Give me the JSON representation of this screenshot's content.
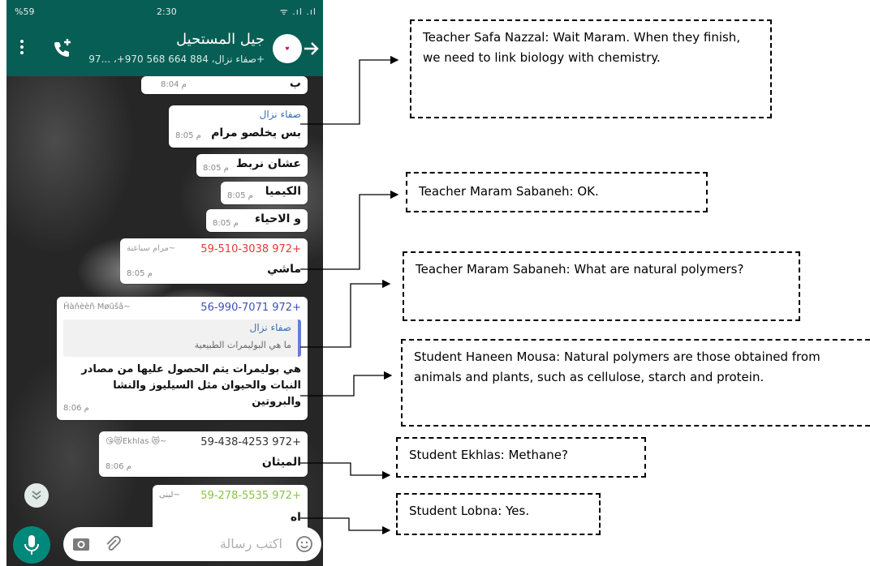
{
  "status_bar": {
    "battery": "%59",
    "time": "2:30",
    "signal": "ᯤ .ıl .ıl"
  },
  "chat_header": {
    "title": "جيل المستحيل",
    "subtitle": "صفاء نزال، 884 664 568 970+، ...97+"
  },
  "messages": {
    "m1": {
      "text": "ب",
      "time": "8:04 م"
    },
    "m2": {
      "sender": "صفاء نزال",
      "text": "بس يخلصو مرام",
      "time": "8:05 م"
    },
    "m3": {
      "text": "عشان نربط",
      "time": "8:05 م"
    },
    "m4": {
      "text": "الكيميا",
      "time": "8:05 م"
    },
    "m5": {
      "text": "و الاحياء",
      "time": "8:05 م"
    },
    "m6": {
      "sender_phone": "+972 59-510-3038",
      "sender_name": "~مرام سباعنة",
      "text": "ماشي",
      "time": "8:05 م"
    },
    "m7": {
      "sender_phone": "+972 56-990-7071",
      "sender_name": "~Ĥàňèèň Møũšâ",
      "quote_author": "صفاء نزال",
      "quote_text": "ما هي البوليمرات الطبيعية",
      "line1": "هي بوليمرات يتم الحصول عليها من مصادر",
      "line2": "النبات والحيوان مثل السيليوز والنشا",
      "line3": "والبروتين",
      "time": "8:06 م"
    },
    "m8": {
      "sender_phone": "+972 59-438-4253",
      "sender_name": "~😻 Ekhlas😻😘",
      "text": "الميثان",
      "time": "8:06 م"
    },
    "m9": {
      "sender_phone": "+972 59-278-5535",
      "sender_name": "~لبنى",
      "text": "اه"
    }
  },
  "input": {
    "placeholder": "اكتب رسالة"
  },
  "annotations": [
    "Teacher Safa Nazzal: Wait Maram. When they finish, we need to link biology with chemistry.",
    "Teacher Maram Sabaneh: OK.",
    "Teacher Maram Sabaneh: What are natural polymers?",
    "Student Haneen Mousa: Natural polymers are those obtained from animals and plants, such as cellulose, starch and protein.",
    "Student Ekhlas: Methane?",
    "Student Lobna: Yes."
  ],
  "colors": {
    "header": "#075e54",
    "mic": "#00897b",
    "phone_red": "#e53935",
    "phone_purple": "#3f51b5",
    "phone_green": "#8bc34a",
    "sender_blue": "#3a6fb0"
  }
}
